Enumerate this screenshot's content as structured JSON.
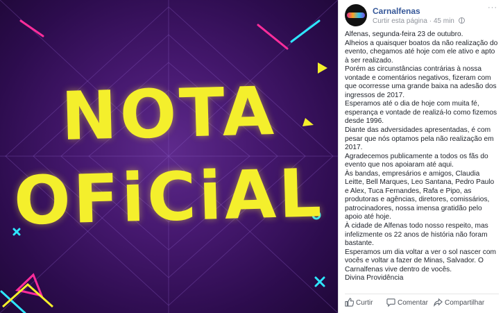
{
  "image": {
    "title_line1": "NOTA",
    "title_line2": "OFiCiAL",
    "colors": {
      "background": "#45186e",
      "title": "#f4ef2c",
      "accent_pink": "#ff2d9b",
      "accent_cyan": "#2ee6ff"
    }
  },
  "post": {
    "page_name": "Carnalfenas",
    "like_page": "Curtir esta página",
    "separator": "·",
    "time": "45 min",
    "privacy_icon": "globe-icon",
    "menu_icon": "more-options-icon",
    "paragraphs": [
      "Alfenas, segunda-feira 23 de outubro.",
      "Alheios a quaisquer boatos da não realização do evento, chegamos até hoje com ele ativo e apto à ser realizado.",
      "Porém as circunstâncias contrárias à nossa vontade e comentários negativos, fizeram com que ocorresse uma grande baixa na adesão dos ingressos de 2017.",
      "Esperamos até o dia de hoje com muita fé, esperança e vontade de realizá-lo como fizemos desde 1996.",
      "Diante das adversidades apresentadas, é com pesar que nós optamos pela não realização em 2017.",
      "Agradecemos publicamente a todos os fãs do evento que nos apoiaram até aqui.",
      "Às bandas, empresários e amigos, Claudia Leitte, Bell Marques, Leo Santana, Pedro Paulo e Alex, Tuca Fernandes, Rafa e Pipo, as produtoras e agências, diretores, comissários, patrocinadores, nossa imensa gratidão pelo apoio até hoje.",
      "À cidade de Alfenas todo nosso respeito, mas infelizmente os 22 anos de história não foram bastante.",
      "Esperamos um dia voltar a ver o sol nascer com vocês e voltar a fazer de Minas, Salvador. O Carnalfenas vive dentro de vocês.",
      "Divina Providência"
    ],
    "actions": {
      "like": "Curtir",
      "comment": "Comentar",
      "share": "Compartilhar"
    },
    "link_color": "#365899"
  }
}
